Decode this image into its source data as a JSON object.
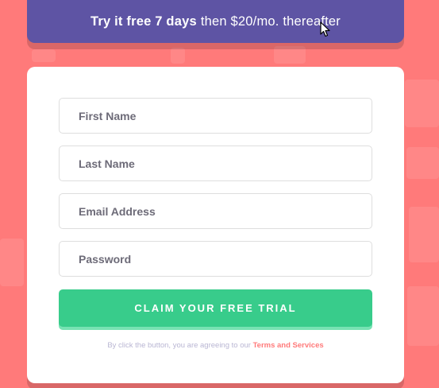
{
  "banner": {
    "bold_text": "Try it free 7 days",
    "rest_text": "then $20/mo. thereafter"
  },
  "form": {
    "first_name_placeholder": "First Name",
    "last_name_placeholder": "Last Name",
    "email_placeholder": "Email Address",
    "password_placeholder": "Password",
    "submit_label": "CLAIM YOUR FREE TRIAL",
    "terms_prefix": "By click the button, you are agreeing to our",
    "terms_link": "Terms and Services"
  },
  "icons": {
    "cursor": "mouse-pointer-icon"
  },
  "colors": {
    "background": "#ff7a7a",
    "banner": "#5e54a4",
    "button": "#38cc8b",
    "button_shadow": "#77e2b3",
    "input_border": "#dedede",
    "terms_text": "#b9b6d3",
    "terms_link": "#ff7a7a"
  }
}
